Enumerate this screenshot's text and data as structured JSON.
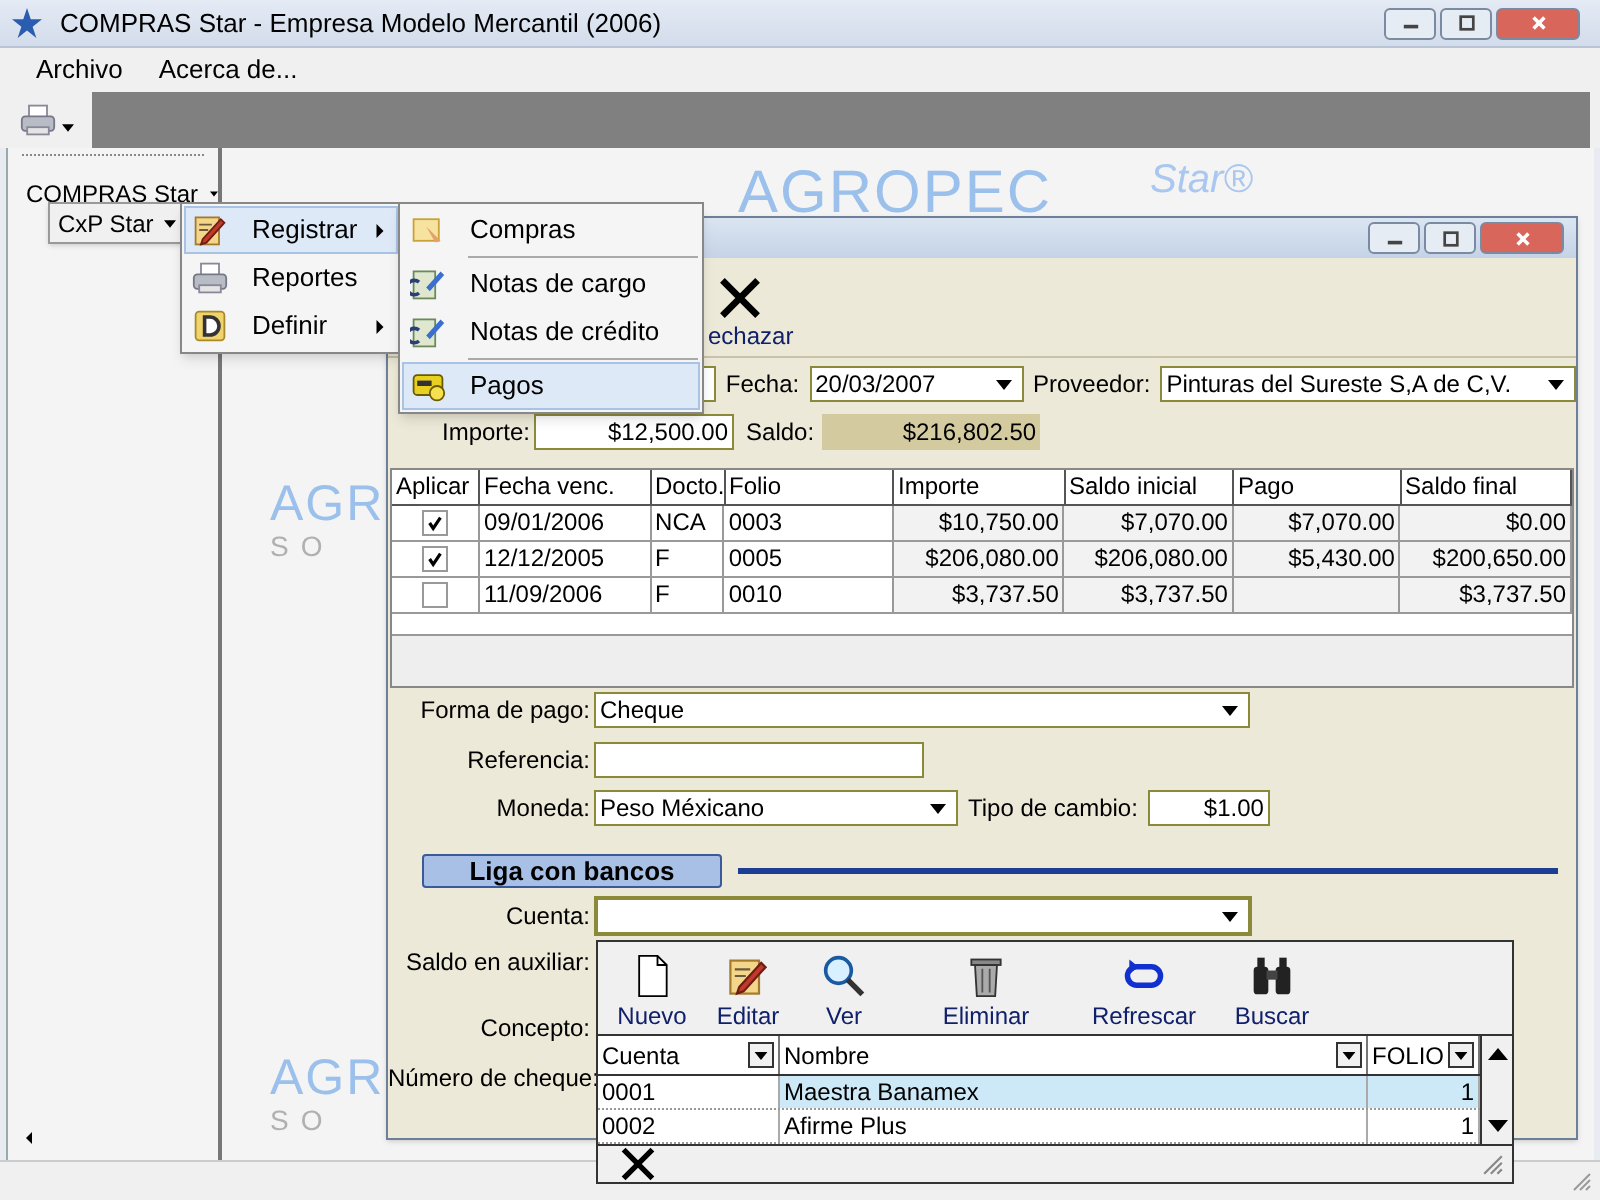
{
  "window": {
    "title": "COMPRAS Star - Empresa Modelo Mercantil (2006)"
  },
  "menu_bar": [
    {
      "label": "Archivo"
    },
    {
      "label": "Acerca de..."
    }
  ],
  "left_panel": {
    "title": "COMPRAS Star"
  },
  "background_logos": [
    {
      "text": "AGROPEC",
      "suffix": "Star®"
    },
    {
      "text": "AGR",
      "suffix": "SO"
    },
    {
      "text": "AGR",
      "suffix": "SO"
    }
  ],
  "menus": {
    "root": {
      "label": "CxP Star"
    },
    "level_1": [
      {
        "label": "Registrar",
        "selected": true,
        "submenu": true
      },
      {
        "label": "Reportes",
        "selected": false,
        "submenu": false
      },
      {
        "label": "Definir",
        "selected": false,
        "submenu": true
      }
    ],
    "level_2": [
      {
        "label": "Compras",
        "selected": false
      },
      {
        "label": "Notas de cargo",
        "selected": false
      },
      {
        "label": "Notas de crédito",
        "selected": false
      },
      {
        "label": "Pagos",
        "selected": true
      }
    ]
  },
  "child_window": {
    "toolbar": [
      {
        "label": "echazar"
      }
    ],
    "fecha_label": "Fecha:",
    "fecha": "20/03/2007",
    "proveedor_label": "Proveedor:",
    "proveedor": "Pinturas del Sureste S,A de C,V.",
    "importe_label": "Importe:",
    "importe": "$12,500.00",
    "saldo_label": "Saldo:",
    "saldo": "$216,802.50",
    "table": {
      "checkbox_column": "Aplicar",
      "columns": [
        "Fecha venc.",
        "Docto.",
        "Folio",
        "Importe",
        "Saldo inicial",
        "Pago",
        "Saldo final"
      ],
      "rows": [
        {
          "checked": true,
          "cells": [
            "09/01/2006",
            "NCA",
            "0003",
            "$10,750.00",
            "$7,070.00",
            "$7,070.00",
            "$0.00"
          ]
        },
        {
          "checked": true,
          "cells": [
            "12/12/2005",
            "F",
            "0005",
            "$206,080.00",
            "$206,080.00",
            "$5,430.00",
            "$200,650.00"
          ]
        },
        {
          "checked": false,
          "cells": [
            "11/09/2006",
            "F",
            "0010",
            "$3,737.50",
            "$3,737.50",
            "",
            "$3,737.50"
          ]
        }
      ]
    },
    "forma_pago_label": "Forma de pago:",
    "forma_pago": "Cheque",
    "referencia_label": "Referencia:",
    "moneda_label": "Moneda:",
    "moneda": "Peso Méxicano",
    "tipo_cambio_label": "Tipo de cambio:",
    "tipo_cambio": "$1.00",
    "liga_button": "Liga con bancos",
    "cuenta_label": "Cuenta:",
    "saldo_auxiliar_label": "Saldo en auxiliar:",
    "concepto_label": "Concepto:",
    "numero_cheque_label": "Número de cheque:"
  },
  "dropdown": {
    "toolbar": [
      {
        "label": "Nuevo"
      },
      {
        "label": "Editar"
      },
      {
        "label": "Ver"
      },
      {
        "label": "Eliminar"
      },
      {
        "label": "Refrescar"
      },
      {
        "label": "Buscar"
      }
    ],
    "columns": [
      "Cuenta",
      "Nombre",
      "FOLIO"
    ],
    "rows": [
      {
        "selected": true,
        "cells": [
          "0001",
          "Maestra Banamex",
          "1"
        ]
      },
      {
        "selected": false,
        "cells": [
          "0002",
          "Afirme Plus",
          "1"
        ]
      }
    ]
  }
}
